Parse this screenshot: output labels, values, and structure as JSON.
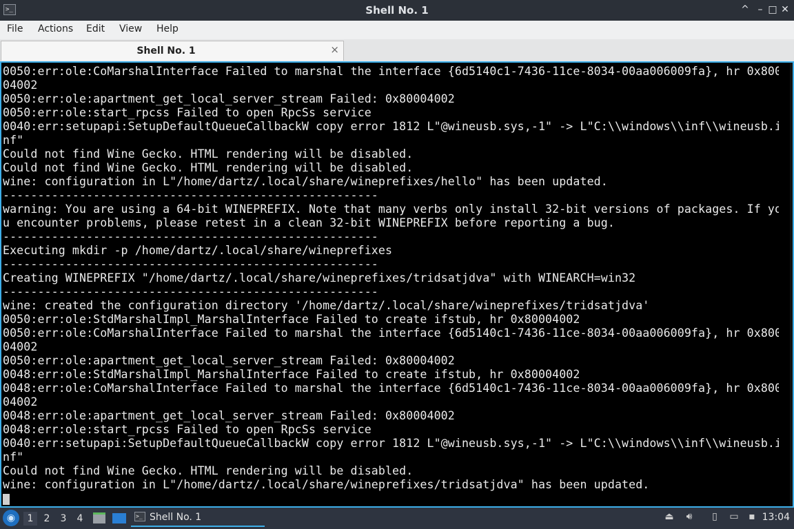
{
  "window": {
    "title": "Shell No. 1",
    "icon": "terminal-icon",
    "controls": {
      "minimize": "–",
      "maximize": "□",
      "close": "✕",
      "restore": "^"
    }
  },
  "menu": {
    "items": [
      "File",
      "Actions",
      "Edit",
      "View",
      "Help"
    ]
  },
  "tabs": [
    {
      "label": "Shell No. 1",
      "close": "×"
    }
  ],
  "terminal": {
    "lines": [
      "0050:err:ole:CoMarshalInterface Failed to marshal the interface {6d5140c1-7436-11ce-8034-00aa006009fa}, hr 0x800",
      "04002",
      "0050:err:ole:apartment_get_local_server_stream Failed: 0x80004002",
      "0050:err:ole:start_rpcss Failed to open RpcSs service",
      "0040:err:setupapi:SetupDefaultQueueCallbackW copy error 1812 L\"@wineusb.sys,-1\" -> L\"C:\\\\windows\\\\inf\\\\wineusb.i",
      "nf\"",
      "Could not find Wine Gecko. HTML rendering will be disabled.",
      "Could not find Wine Gecko. HTML rendering will be disabled.",
      "wine: configuration in L\"/home/dartz/.local/share/wineprefixes/hello\" has been updated.",
      "------------------------------------------------------",
      "warning: You are using a 64-bit WINEPREFIX. Note that many verbs only install 32-bit versions of packages. If yo",
      "u encounter problems, please retest in a clean 32-bit WINEPREFIX before reporting a bug.",
      "------------------------------------------------------",
      "Executing mkdir -p /home/dartz/.local/share/wineprefixes",
      "------------------------------------------------------",
      "Creating WINEPREFIX \"/home/dartz/.local/share/wineprefixes/tridsatjdva\" with WINEARCH=win32",
      "------------------------------------------------------",
      "wine: created the configuration directory '/home/dartz/.local/share/wineprefixes/tridsatjdva'",
      "0050:err:ole:StdMarshalImpl_MarshalInterface Failed to create ifstub, hr 0x80004002",
      "0050:err:ole:CoMarshalInterface Failed to marshal the interface {6d5140c1-7436-11ce-8034-00aa006009fa}, hr 0x800",
      "04002",
      "0050:err:ole:apartment_get_local_server_stream Failed: 0x80004002",
      "0048:err:ole:StdMarshalImpl_MarshalInterface Failed to create ifstub, hr 0x80004002",
      "0048:err:ole:CoMarshalInterface Failed to marshal the interface {6d5140c1-7436-11ce-8034-00aa006009fa}, hr 0x800",
      "04002",
      "0048:err:ole:apartment_get_local_server_stream Failed: 0x80004002",
      "0048:err:ole:start_rpcss Failed to open RpcSs service",
      "0040:err:setupapi:SetupDefaultQueueCallbackW copy error 1812 L\"@wineusb.sys,-1\" -> L\"C:\\\\windows\\\\inf\\\\wineusb.i",
      "nf\"",
      "Could not find Wine Gecko. HTML rendering will be disabled.",
      "wine: configuration in L\"/home/dartz/.local/share/wineprefixes/tridsatjdva\" has been updated."
    ]
  },
  "taskbar": {
    "start_icon": "start-menu-icon",
    "workspaces": [
      "1",
      "2",
      "3",
      "4"
    ],
    "active_workspace": "1",
    "task": {
      "label": "Shell No. 1",
      "icon": "terminal-icon"
    },
    "tray": [
      "upload-icon",
      "volume-icon",
      "clipboard-icon",
      "network-icon",
      "display-icon"
    ],
    "clock": "13:04"
  },
  "colors": {
    "accent": "#3daee9",
    "terminal_bg": "#000000",
    "terminal_fg": "#eaeaea"
  }
}
